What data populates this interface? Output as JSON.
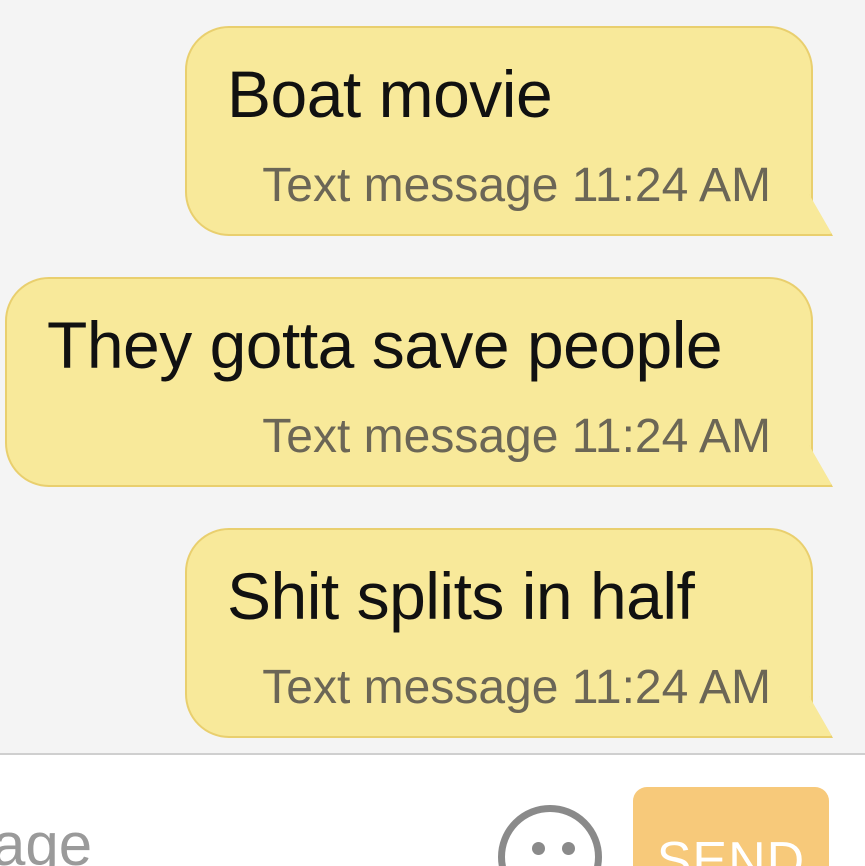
{
  "messages": [
    {
      "text": "Boat movie",
      "meta": "Text message 11:24 AM"
    },
    {
      "text": "They gotta save people",
      "meta": "Text message 11:24 AM"
    },
    {
      "text": "Shit splits in half",
      "meta": "Text message 11:24 AM"
    }
  ],
  "composer": {
    "placeholder": "age",
    "send_label": "SEND",
    "emoji_icon": "smiley-face-icon"
  },
  "colors": {
    "bubble_fill": "#f8e99a",
    "bubble_border": "#e9cf6e",
    "send_button": "#f7c97a",
    "background": "#f4f4f4"
  }
}
